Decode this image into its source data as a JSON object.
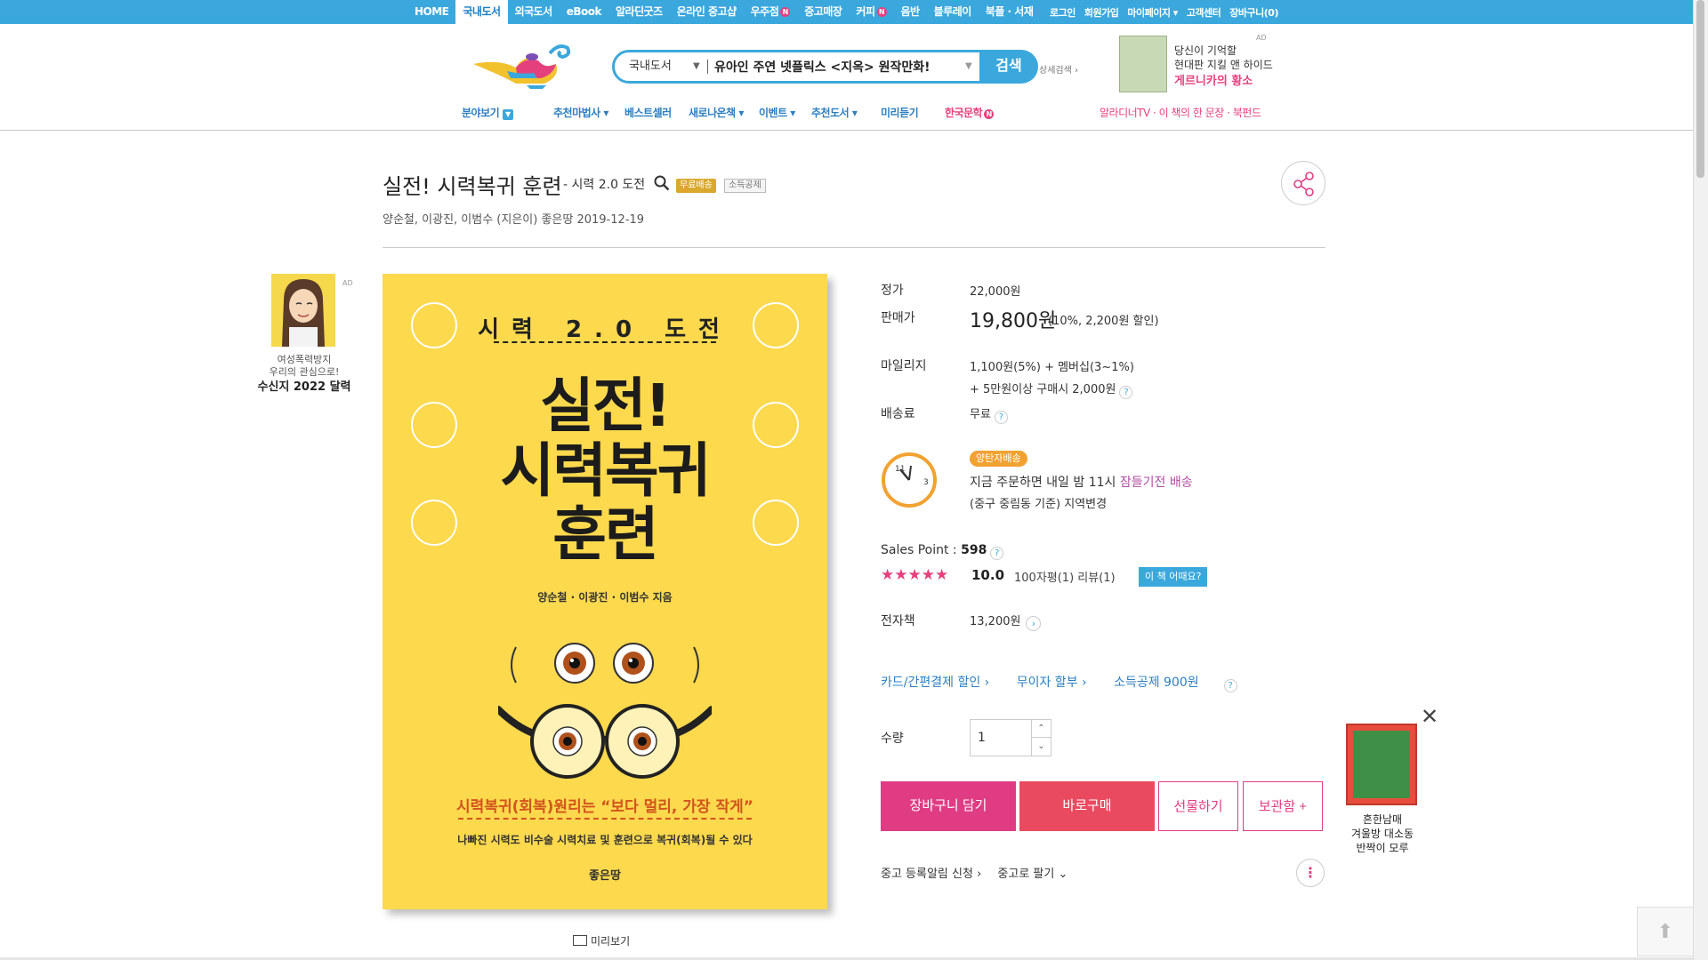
{
  "topnav": {
    "items": [
      "HOME",
      "국내도서",
      "외국도서",
      "eBook",
      "알라딘굿즈",
      "온라인 중고샵",
      "우주점",
      "중고매장",
      "커피",
      "음반",
      "블루레이",
      "북플 · 서재"
    ],
    "new_badge": "N",
    "right": [
      "로그인",
      "회원가입",
      "마이페이지 ▾",
      "고객센터",
      "장바구니(0)"
    ]
  },
  "search": {
    "category": "국내도서",
    "query": "유아인 주연 넷플릭스 <지옥> 원작만화!",
    "button": "검색",
    "advanced": "상세검색 ›"
  },
  "header_ad": {
    "line1": "당신이 기억할",
    "line2": "현대판 지킬 앤 하이드",
    "line3": "게르니카의 황소",
    "tag": "AD"
  },
  "gnb": {
    "browse": "분야보기",
    "items": [
      "추천마법사 ▾",
      "베스트셀러",
      "새로나온책 ▾",
      "이벤트 ▾",
      "추천도서 ▾",
      "미리듣기"
    ],
    "korean_lit": "한국문학",
    "right": "알라디너TV · 이 책의 한 문장 · 북펀드"
  },
  "book": {
    "title": "실전! 시력복귀 훈련",
    "subtitle": "- 시력 2.0 도전",
    "badge_free": "무료배송",
    "badge_tax": "소득공제",
    "authors": "양순철,   이광진,   이범수 (지은이)   좋은땅   2019-12-19"
  },
  "side_ad": {
    "tag": "AD",
    "line1": "여성폭력방지",
    "line2": "우리의 관심으로!",
    "line3": "수신지 2022 달력"
  },
  "cover": {
    "top_title": "시력 2.0 도전",
    "line1": "실전!",
    "line2": "시력복귀",
    "line3": "훈련",
    "authors": "양순철 · 이광진 · 이범수 지음",
    "tagline": "시력복귀(회복)원리는 “보다 멀리, 가장 작게”",
    "tagline2": "나빠진 시력도 비수술 시력치료 및 훈련으로 복귀(회복)될 수 있다",
    "publisher": "좋은땅"
  },
  "preview": "미리보기",
  "price": {
    "list_label": "정가",
    "list_value": "22,000원",
    "sale_label": "판매가",
    "sale_value": "19,800원",
    "sale_detail": "(10%, 2,200원 할인)",
    "mileage_label": "마일리지",
    "mileage_1": "1,100원(5%) + 멤버십(3~1%)",
    "mileage_2": "+ 5만원이상 구매시 2,000원",
    "ship_label": "배송료",
    "ship_value": "무료"
  },
  "delivery": {
    "badge": "양탄자배송",
    "line1_a": "지금 주문하면 내일 밤 11시 ",
    "line1_b": "잠들기전 배송",
    "line2": "(중구 중림동 기준) 지역변경"
  },
  "sales": {
    "label": "Sales Point : ",
    "value": "598",
    "stars": "★★★★★",
    "rating": "10.0",
    "counts": "100자평(1)   리뷰(1)",
    "how": "이 책 어때요?"
  },
  "ebook": {
    "label": "전자책",
    "value": "13,200원"
  },
  "pay_links": {
    "card": "카드/간편결제 할인 ›",
    "installment": "무이자 할부 ›",
    "tax": "소득공제 900원"
  },
  "quantity": {
    "label": "수량",
    "value": "1"
  },
  "buttons": {
    "cart": "장바구니 담기",
    "buy": "바로구매",
    "gift": "선물하기",
    "keep": "보관함 +"
  },
  "used": {
    "alert": "중고 등록알림 신청 ›",
    "sell": "중고로 팔기 ⌄"
  },
  "float_ad": {
    "line1": "흔한남매",
    "line2": "겨울방 대소동",
    "line3": "반짝이 모루"
  },
  "colors": {
    "brand_blue": "#3aa8dc",
    "pink": "#e03c84",
    "cover_yellow": "#fcd94d"
  }
}
